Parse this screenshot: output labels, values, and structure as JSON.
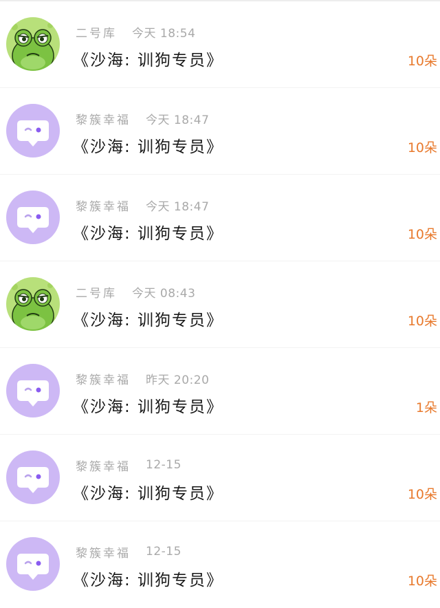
{
  "messages": [
    {
      "sender": "二号库",
      "time": "今天 18:54",
      "title": "《沙海: 训狗专员》",
      "count": "10朵",
      "avatar": "frog-icon"
    },
    {
      "sender": "黎簇幸福",
      "time": "今天 18:47",
      "title": "《沙海: 训狗专员》",
      "count": "10朵",
      "avatar": "chat-bubble-icon"
    },
    {
      "sender": "黎簇幸福",
      "time": "今天 18:47",
      "title": "《沙海: 训狗专员》",
      "count": "10朵",
      "avatar": "chat-bubble-icon"
    },
    {
      "sender": "二号库",
      "time": "今天 08:43",
      "title": "《沙海: 训狗专员》",
      "count": "10朵",
      "avatar": "frog-icon"
    },
    {
      "sender": "黎簇幸福",
      "time": "昨天 20:20",
      "title": "《沙海: 训狗专员》",
      "count": "1朵",
      "avatar": "chat-bubble-icon"
    },
    {
      "sender": "黎簇幸福",
      "time": "12-15",
      "title": "《沙海: 训狗专员》",
      "count": "10朵",
      "avatar": "chat-bubble-icon"
    },
    {
      "sender": "黎簇幸福",
      "time": "12-15",
      "title": "《沙海: 训狗专员》",
      "count": "10朵",
      "avatar": "chat-bubble-icon"
    }
  ],
  "colors": {
    "count": "#e8792c",
    "meta": "#a9a9a9",
    "title": "#1a1a1a",
    "avatar_purple": "#cdb8f5",
    "avatar_green": "#8fd14f"
  }
}
